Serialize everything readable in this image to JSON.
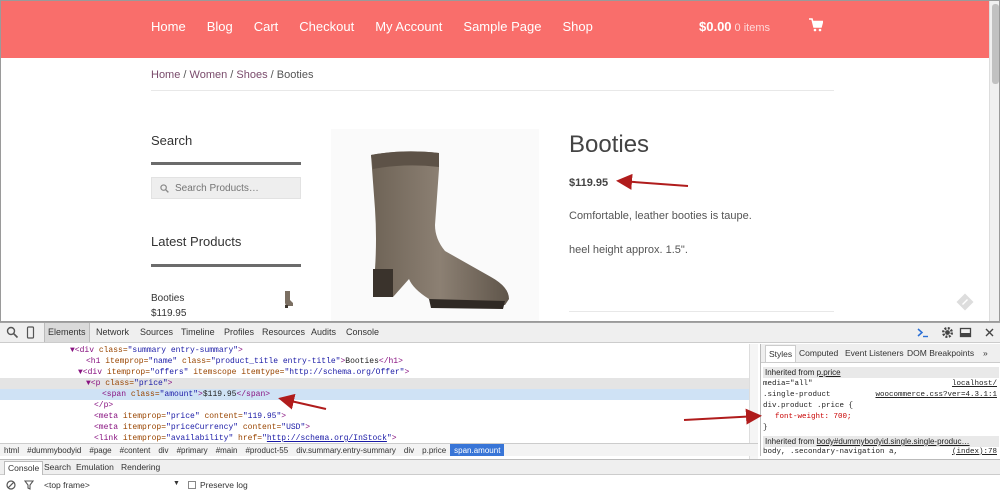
{
  "nav": {
    "items": [
      "Home",
      "Blog",
      "Cart",
      "Checkout",
      "My Account",
      "Sample Page",
      "Shop"
    ],
    "cart_total": "$0.00",
    "cart_items": "0 items"
  },
  "breadcrumb": {
    "home": "Home",
    "sep": " / ",
    "women": "Women",
    "shoes": "Shoes",
    "current": "Booties"
  },
  "sidebar": {
    "search_title": "Search",
    "search_placeholder": "Search Products…",
    "latest_title": "Latest Products",
    "latest_item_name": "Booties",
    "latest_item_price": "$119.95"
  },
  "product": {
    "title": "Booties",
    "price": "$119.95",
    "desc1": "Comfortable, leather booties is taupe.",
    "desc2": "heel height approx. 1.5\"."
  },
  "devtools": {
    "tabs": [
      "Elements",
      "Network",
      "Sources",
      "Timeline",
      "Profiles",
      "Resources",
      "Audits",
      "Console"
    ],
    "dom": {
      "l1_tag": "▼<div ",
      "l1_attr": "class=",
      "l1_val": "\"summary entry-summary\"",
      "l1_end": ">",
      "l2_tag": "<h1 ",
      "l2_a1": "itemprop=",
      "l2_v1": "\"name\"",
      "l2_a2": " class=",
      "l2_v2": "\"product_title entry-title\"",
      "l2_gt": ">",
      "l2_txt": "Booties",
      "l2_end": "</h1>",
      "l3_tag": "▼<div ",
      "l3_a1": "itemprop=",
      "l3_v1": "\"offers\"",
      "l3_a2": " itemscope itemtype=",
      "l3_v2": "\"http://schema.org/Offer\"",
      "l3_end": ">",
      "l4_tag": "▼<p ",
      "l4_attr": "class=",
      "l4_val": "\"price\"",
      "l4_end": ">",
      "l5_tag": "<span ",
      "l5_attr": "class=",
      "l5_val": "\"amount\"",
      "l5_gt": ">",
      "l5_txt": "$119.95",
      "l5_end": "</span>",
      "l6": "</p>",
      "l7_tag": "<meta ",
      "l7_a1": "itemprop=",
      "l7_v1": "\"price\"",
      "l7_a2": " content=",
      "l7_v2": "\"119.95\"",
      "l7_end": ">",
      "l8_tag": "<meta ",
      "l8_a1": "itemprop=",
      "l8_v1": "\"priceCurrency\"",
      "l8_a2": " content=",
      "l8_v2": "\"USD\"",
      "l8_end": ">",
      "l9_tag": "<link ",
      "l9_a1": "itemprop=",
      "l9_v1": "\"availability\"",
      "l9_a2": " href=",
      "l9_q1": "\"",
      "l9_url": "http://schema.org/InStock",
      "l9_q2": "\"",
      "l9_end": ">"
    },
    "crumbs": [
      "html",
      "#dummybodyid",
      "#page",
      "#content",
      "div",
      "#primary",
      "#main",
      "#product-55",
      "div.summary.entry-summary",
      "div",
      "p.price",
      "span.amount"
    ],
    "styles_tabs": [
      "Styles",
      "Computed",
      "Event Listeners",
      "DOM Breakpoints",
      "»"
    ],
    "styles": {
      "inherited1_label": "Inherited from ",
      "inherited1_link": "p.price",
      "media": "media=\"all\"",
      "media_src": "localhost/",
      "sel1": ".single-product",
      "sel1_src": "woocommerce.css?ver=4.3.1:1",
      "sel2": "div.product .price {",
      "prop": "font-weight: 700;",
      "close": "}",
      "inherited2_label": "Inherited from ",
      "inherited2_link": "body#dummybodyid.single.single-produc…",
      "last": "body, .secondary-navigation a,",
      "last_src": "(index):78"
    },
    "console_tabs": [
      "Console",
      "Search",
      "Emulation",
      "Rendering"
    ],
    "frame": "<top frame>",
    "preserve_log": "Preserve log"
  }
}
